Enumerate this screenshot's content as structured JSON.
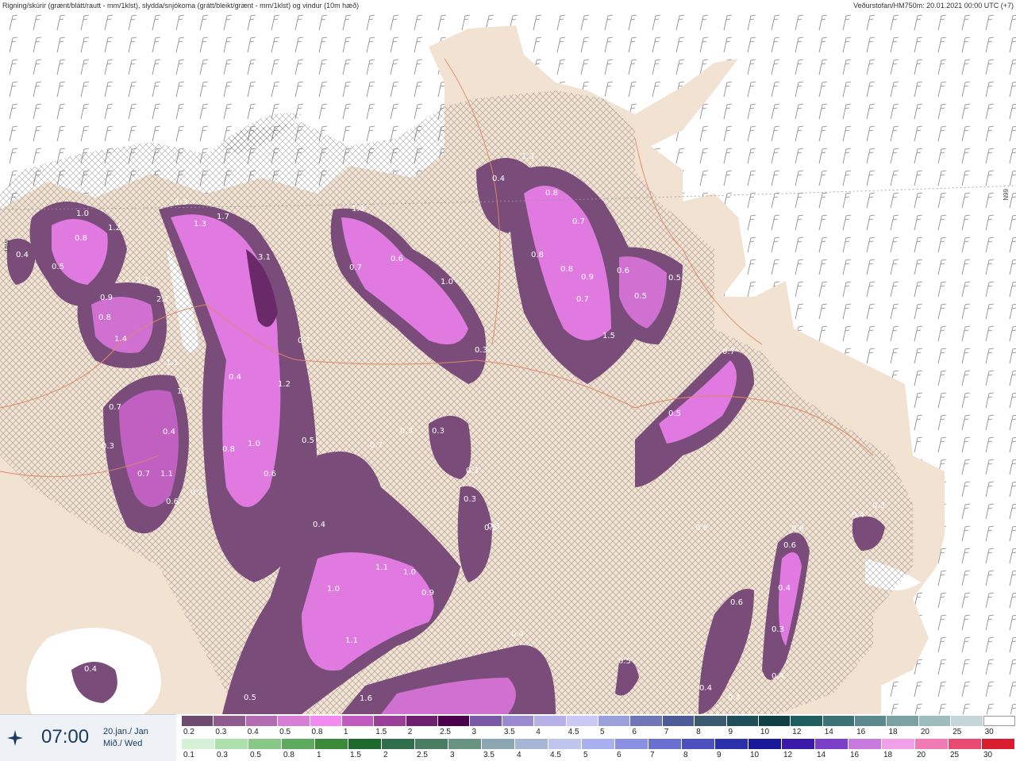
{
  "header": {
    "left_text": "Rigning/skúrir (grænt/blátt/rautt - mm/1klst), slydda/snjókoma (grátt/bleikt/grænt - mm/1klst) og vindur (10m hæð)",
    "right_text": "Veðurstofan/HM750m: 20.01.2021 00:00 UTC (+7)"
  },
  "map_edge_labels": {
    "left": "15W",
    "right": "66N"
  },
  "footer": {
    "time": "07:00",
    "date_line1": "20.jan./ Jan",
    "date_line2": "Mið./ Wed",
    "logo_icon": "vedurstofan-logo-icon"
  },
  "legend": {
    "snow_scale": {
      "labels": [
        "0.2",
        "0.3",
        "0.4",
        "0.5",
        "0.8",
        "1",
        "1.5",
        "2",
        "2.5",
        "3",
        "3.5",
        "4",
        "4.5",
        "5",
        "6",
        "7",
        "8",
        "9",
        "10",
        "12",
        "14",
        "16",
        "18",
        "20",
        "25",
        "30"
      ],
      "colors": [
        "#6e4a6e",
        "#8f5a8f",
        "#b36bb3",
        "#d77fd7",
        "#f28af2",
        "#c05ac0",
        "#9a3e9a",
        "#6e1f6e",
        "#4a004a",
        "#7a58a8",
        "#9c8ad0",
        "#b6b0e8",
        "#cac8f4",
        "#9aa0dc",
        "#6e76b8",
        "#4e5a98",
        "#3a5a70",
        "#1e4e58",
        "#0f4044",
        "#1f5e60",
        "#3a7276",
        "#5a8a8e",
        "#7aa2a4",
        "#9cbcbe",
        "#c4d6d8",
        "#ffffff"
      ]
    },
    "rain_scale": {
      "labels": [
        "0.1",
        "0.3",
        "0.5",
        "0.8",
        "1",
        "1.5",
        "2",
        "2.5",
        "3",
        "3.5",
        "4",
        "4.5",
        "5",
        "6",
        "7",
        "8",
        "9",
        "10",
        "12",
        "14",
        "16",
        "18",
        "20",
        "25",
        "30"
      ],
      "colors": [
        "#d6f2d6",
        "#aee0ae",
        "#86c886",
        "#5eaa5e",
        "#3a8a3a",
        "#1e6a2e",
        "#2f6e4a",
        "#4a7e64",
        "#6a9482",
        "#8aa6b0",
        "#a8b6d6",
        "#bfc6ee",
        "#a8b0f0",
        "#8a90e2",
        "#6a70d0",
        "#4a50bc",
        "#2a30a8",
        "#1a1a98",
        "#3a1aa8",
        "#7a40c8",
        "#c87ae0",
        "#f0a0e8",
        "#f07ab4",
        "#e84a70",
        "#d81e2e"
      ]
    }
  },
  "precip_labels": [
    "0.4",
    "0.5",
    "1.0",
    "1.2",
    "0.8",
    "1.1",
    "2.1",
    "0.9",
    "0.8",
    "1.4",
    "1.1",
    "1.1",
    "0.7",
    "0.4",
    "0.3",
    "0.7",
    "1.1",
    "0.6",
    "0.3",
    "1.3",
    "1.3",
    "1.7",
    "3.1",
    "0.7",
    "1.2",
    "0.4",
    "0.8",
    "1.0",
    "0.5",
    "0.6",
    "0.4",
    "1.4",
    "0.7",
    "0.6",
    "1.0",
    "0.3",
    "0.3",
    "0.3",
    "0.7",
    "0.3",
    "0.3",
    "0.3",
    "0.5",
    "0.4",
    "1.3",
    "0.8",
    "0.7",
    "0.8",
    "0.8",
    "0.9",
    "0.7",
    "0.6",
    "0.5",
    "0.5",
    "1.5",
    "0.7",
    "0.5",
    "0.6",
    "0.6",
    "0.6",
    "0.6",
    "0.4",
    "0.3",
    "0.4",
    "0.4",
    "1.1",
    "1.0",
    "1.0",
    "0.9",
    "1.1",
    "1.6",
    "0.5",
    "0.4",
    "0.4",
    "0.5",
    "0.4",
    "0.4",
    "0.3"
  ]
}
